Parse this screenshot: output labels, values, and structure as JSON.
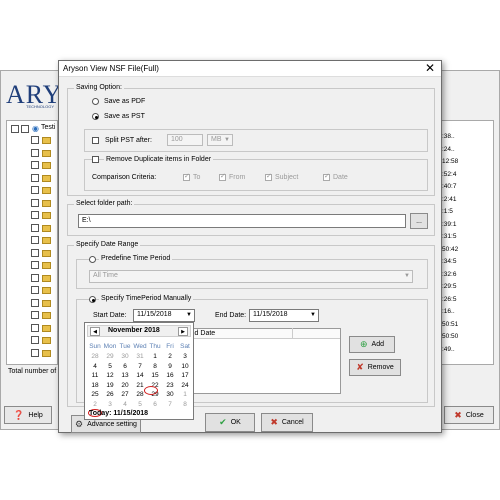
{
  "background_app": {
    "logo": "ARYS",
    "logo_sub": "TECHNOLOGY",
    "tree_root": "Testi",
    "right_column": [
      ":38..",
      ":24..",
      "12:58",
      ":52:4",
      ":40:7",
      ":2:41",
      ":1:5",
      ":39:1",
      ":31:5",
      "50:42",
      ":34:5",
      ":32:6",
      ":29:5",
      ":26:5",
      ":16..",
      "50:51",
      "50:50",
      ":49.."
    ],
    "total_label": "Total number of",
    "help_label": "Help",
    "close_label": "Close"
  },
  "dialog": {
    "title": "Aryson View NSF File(Full)",
    "saving_option": {
      "legend": "Saving Option:",
      "pdf_label": "Save as PDF",
      "pst_label": "Save as PST",
      "split_label": "Split PST after:",
      "split_value": "100",
      "split_unit": "MB",
      "remove_dup_label": "Remove Duplicate items in Folder",
      "comparison_label": "Comparison Criteria:",
      "criteria": [
        "To",
        "From",
        "Subject",
        "Date"
      ]
    },
    "folder": {
      "legend": "Select folder path:",
      "path": "E:\\",
      "browse_label": "..."
    },
    "date_range": {
      "legend": "Specify Date Range",
      "predefine_label": "Predefine Time Period",
      "predefine_value": "All Time",
      "manual_label": "Specify TimePeriod Manually",
      "start_label": "Start Date:",
      "start_value": "11/15/2018",
      "end_label": "End Date:",
      "end_value": "11/15/2018",
      "end_col_header": "End Date",
      "add_label": "Add",
      "remove_label": "Remove"
    },
    "calendar": {
      "month": "November 2018",
      "dow": [
        "Sun",
        "Mon",
        "Tue",
        "Wed",
        "Thu",
        "Fri",
        "Sat"
      ],
      "weeks": [
        [
          "28",
          "29",
          "30",
          "31",
          "1",
          "2",
          "3"
        ],
        [
          "4",
          "5",
          "6",
          "7",
          "8",
          "9",
          "10"
        ],
        [
          "11",
          "12",
          "13",
          "14",
          "15",
          "16",
          "17"
        ],
        [
          "18",
          "19",
          "20",
          "21",
          "22",
          "23",
          "24"
        ],
        [
          "25",
          "26",
          "27",
          "28",
          "29",
          "30",
          "1"
        ],
        [
          "2",
          "3",
          "4",
          "5",
          "6",
          "7",
          "8"
        ]
      ],
      "today": "Today: 11/15/2018"
    },
    "advance_label": "Advance setting",
    "ok_label": "OK",
    "cancel_label": "Cancel"
  }
}
